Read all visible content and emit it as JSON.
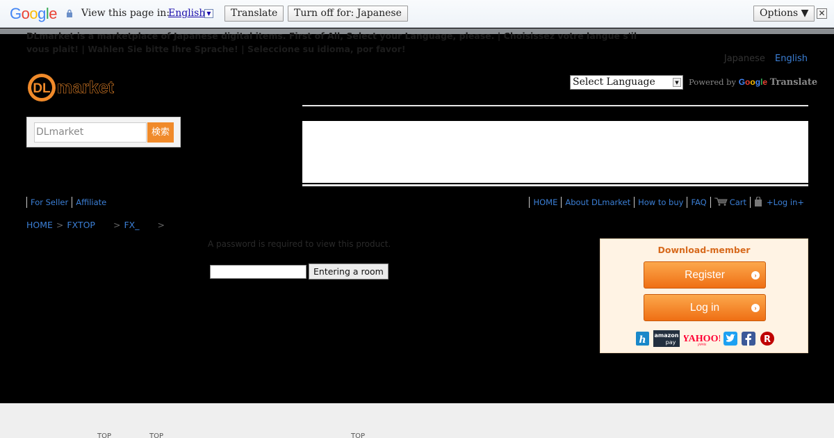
{
  "translate_bar": {
    "logo": "Google",
    "view_text": "View this page in:",
    "language": "English",
    "translate_label": "Translate",
    "turn_off_label": "Turn off for: Japanese",
    "options_label": "Options ▼",
    "close_glyph": "✕"
  },
  "notice": "DLmarket is a marketplace of Japanese digital items. First of All, Select your Language, please. | Choisissez votre langue s'il vous plait! | Wahlen Sie bitte Ihre Sprache! | Seleccione su idioma, por favor!",
  "language_links": {
    "japanese": "Japanese",
    "english": "English"
  },
  "site": {
    "logo_text": "market"
  },
  "google_translate": {
    "select_label": "Select Language",
    "powered_by": "Powered by",
    "google": "Google",
    "translate": "Translate"
  },
  "search": {
    "placeholder": "DLmarket",
    "button": "検索"
  },
  "left_nav": [
    "For Seller",
    "Affiliate"
  ],
  "right_nav": [
    "HOME",
    "About DLmarket",
    "How to buy",
    "FAQ",
    "Cart",
    "+Log in+"
  ],
  "breadcrumb": {
    "home": "HOME",
    "fxtop": "FXTOP",
    "fx": "FX_"
  },
  "password": {
    "message": "A password is required to view this product.",
    "button": "Entering a room"
  },
  "member": {
    "title": "Download-member",
    "register": "Register",
    "login": "Log in",
    "social": [
      "hatena",
      "amazon pay",
      "YAHOO!",
      "twitter",
      "facebook",
      "rakuten"
    ]
  },
  "footer": {
    "labels": [
      "TOP",
      "TOP",
      "TOP"
    ]
  },
  "colors": {
    "accent": "#f08a2a",
    "link": "#3b7fd6",
    "member_bg": "#fff3e4"
  }
}
